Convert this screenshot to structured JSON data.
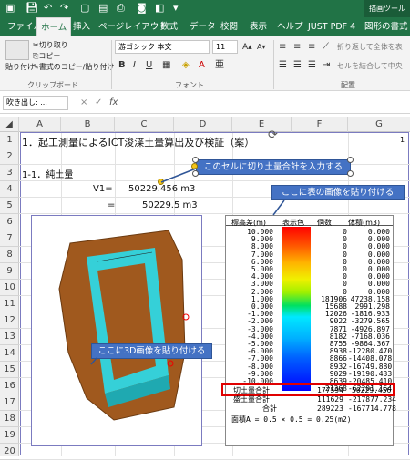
{
  "titlebar": {
    "save_icon": "save-icon",
    "undo_icon": "undo-icon",
    "redo_icon": "redo-icon",
    "context_label": "描画ツール"
  },
  "tabs": [
    "ファイル",
    "ホーム",
    "挿入",
    "ページレイアウト",
    "数式",
    "データ",
    "校閲",
    "表示",
    "ヘルプ",
    "JUST PDF 4",
    "図形の書式"
  ],
  "ribbon": {
    "paste": "貼り付け",
    "cut": "切り取り",
    "copy": "コピー",
    "format_painter": "書式のコピー/貼り付け",
    "clipboard": "クリップボード",
    "font_name": "游ゴシック 本文",
    "font_size": "11",
    "bold": "B",
    "italic": "I",
    "underline": "U",
    "font_group": "フォント",
    "wrap": "折り返して全体を表",
    "merge": "セルを結合して中央",
    "align_group": "配置"
  },
  "formula_bar": {
    "name_box": "吹き出し: ...",
    "cancel": "×",
    "enter": "✓",
    "fx": "fx",
    "value": ""
  },
  "columns": [
    "A",
    "B",
    "C",
    "D",
    "E",
    "F",
    "G"
  ],
  "rows": [
    "1",
    "2",
    "3",
    "4",
    "5",
    "6",
    "7",
    "8",
    "9",
    "10",
    "11",
    "12",
    "13",
    "14",
    "15",
    "16",
    "17",
    "18",
    "19",
    "20"
  ],
  "cells": {
    "a1": "1．起工測量によるICT浚渫土量算出及び検証（案）",
    "g1": "1",
    "a3": "1-1．純土量",
    "b4": "V1=",
    "c4": "50229.456 m3",
    "b5": "=",
    "c5": "50229.5 m3"
  },
  "callouts": {
    "cut_fill": "このセルに切り土量合計を入力する",
    "table_image": "ここに表の画像を貼り付ける",
    "image_3d": "ここに3D画像を貼り付ける"
  },
  "table": {
    "headers": [
      "標高差(m)",
      "表示色",
      "個数",
      "体積(m3)"
    ],
    "rows": [
      [
        "10.000",
        "0",
        "0.000"
      ],
      [
        "9.000",
        "0",
        "0.000"
      ],
      [
        "8.000",
        "0",
        "0.000"
      ],
      [
        "7.000",
        "0",
        "0.000"
      ],
      [
        "6.000",
        "0",
        "0.000"
      ],
      [
        "5.000",
        "0",
        "0.000"
      ],
      [
        "4.000",
        "0",
        "0.000"
      ],
      [
        "3.000",
        "0",
        "0.000"
      ],
      [
        "2.000",
        "0",
        "0.000"
      ],
      [
        "1.000",
        "181906",
        "47238.158"
      ],
      [
        "0.000",
        "15688",
        "2991.298"
      ],
      [
        "-1.000",
        "12026",
        "-1816.933"
      ],
      [
        "-2.000",
        "9022",
        "-3279.565"
      ],
      [
        "-3.000",
        "7871",
        "-4926.897"
      ],
      [
        "-4.000",
        "8182",
        "-7168.036"
      ],
      [
        "-5.000",
        "8755",
        "-9864.367"
      ],
      [
        "-6.000",
        "8938",
        "-12280.470"
      ],
      [
        "-7.000",
        "8866",
        "-14408.078"
      ],
      [
        "-8.000",
        "8932",
        "-16749.880"
      ],
      [
        "-9.000",
        "9029",
        "-19190.433"
      ],
      [
        "-10.000",
        "8639",
        "-20485.410"
      ],
      [
        "",
        "21368",
        "-62201.164"
      ]
    ],
    "summary": [
      {
        "label": "切土量合計",
        "count": "177594",
        "value": "50229.456"
      },
      {
        "label": "盛土量合計",
        "count": "111629",
        "value": "-217877.234"
      },
      {
        "label": "合計",
        "count": "289223",
        "value": "-167714.778"
      }
    ],
    "area_note": "面積A = 0.5 × 0.5 = 0.25(m2)"
  },
  "colors": {
    "excel_green": "#217346",
    "callout_blue": "#4472c4",
    "fill_tan": "#a0591e",
    "cyan": "#35d0d8",
    "highlight_red": "#e00000"
  }
}
